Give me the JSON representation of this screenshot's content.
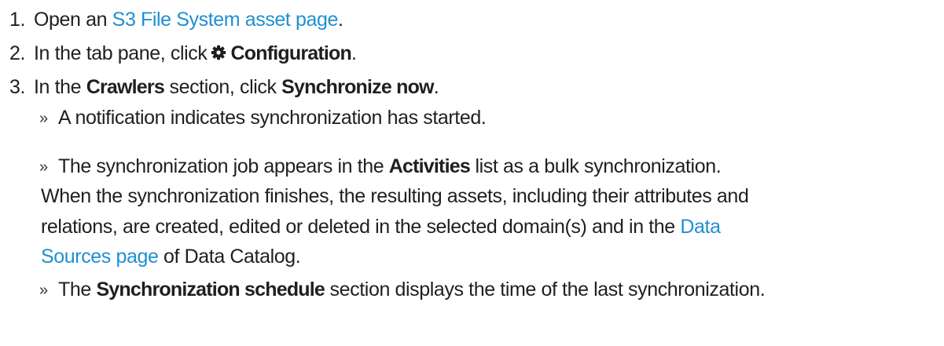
{
  "steps": [
    {
      "number": "1.",
      "parts": {
        "t1": "Open an ",
        "link": "S3 File System asset page",
        "t2": "."
      }
    },
    {
      "number": "2.",
      "parts": {
        "t1": "In the tab pane, click",
        "icon": "gear-icon",
        "bold": "Configuration",
        "t2": "."
      }
    },
    {
      "number": "3.",
      "parts": {
        "t1": "In the ",
        "bold1": "Crawlers",
        "t2": " section, click ",
        "bold2": "Synchronize now",
        "t3": "."
      }
    }
  ],
  "results": [
    {
      "bullet": "»",
      "text": "A notification indicates synchronization has started."
    },
    {
      "bullet": "»",
      "t1": "The synchronization job appears in the ",
      "bold": "Activities",
      "t2": " list as a bulk synchronization.",
      "line2": " When the synchronization finishes, the resulting assets, including their attributes and",
      "line3a": "relations, are created, edited or deleted in the selected domain(s) and in the ",
      "link_part1": "Data",
      "link_part2": "Sources page",
      "line4b": " of Data Catalog."
    },
    {
      "bullet": "»",
      "t1": "The ",
      "bold": "Synchronization schedule",
      "t2": " section displays the time of the last synchronization."
    }
  ],
  "colors": {
    "text": "#1f1f1f",
    "link": "#1f8fd1"
  }
}
